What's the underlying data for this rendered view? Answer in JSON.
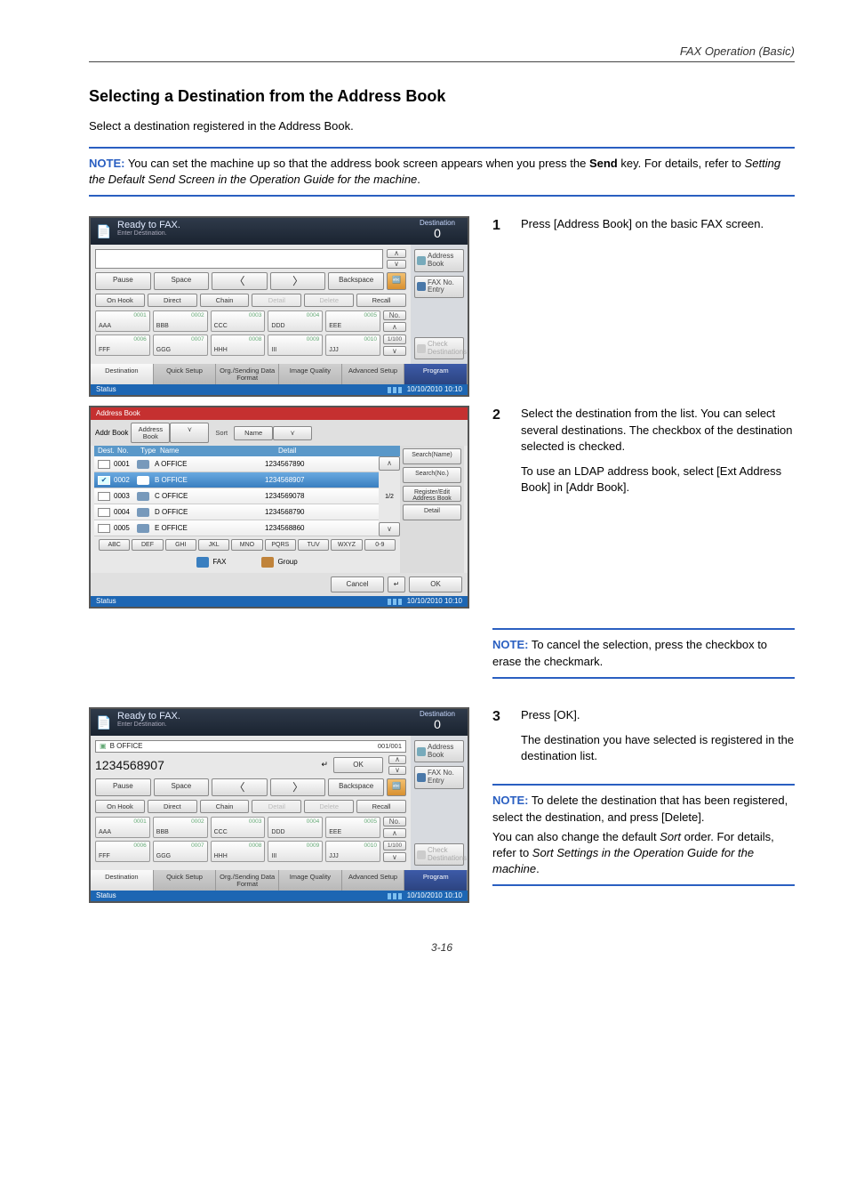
{
  "doc": {
    "running_header": "FAX Operation (Basic)",
    "section_title": "Selecting a Destination from the Address Book",
    "intro": "Select a destination registered in the Address Book.",
    "note1_label": "NOTE:",
    "note1_body_a": " You can set the machine up so that the address book screen appears when you press the ",
    "note1_body_b": "Send",
    "note1_body_c": " key. For details, refer to ",
    "note1_body_d": "Setting the Default Send Screen in the Operation Guide for the machine",
    "note1_body_e": ".",
    "step1_num": "1",
    "step1_text": "Press [Address Book] on the basic FAX screen.",
    "step2_num": "2",
    "step2_text1": "Select the destination from the list. You can select several destinations. The checkbox of the destination selected is checked.",
    "step2_text2": "To use an LDAP address book, select [Ext Address Book] in [Addr Book].",
    "note2_label": "NOTE:",
    "note2_body": " To cancel the selection, press the checkbox to erase the checkmark.",
    "step3_num": "3",
    "step3_text1": "Press [OK].",
    "step3_text2": "The destination you have selected is registered in the destination list.",
    "note3_label": "NOTE:",
    "note3_body": " To delete the destination that has been registered, select the destination, and press [Delete].",
    "note3_extra_a": "You can also change the default ",
    "note3_extra_b": "Sort",
    "note3_extra_c": " order. For details, refer to ",
    "note3_extra_d": "Sort Settings in the Operation Guide for the machine",
    "note3_extra_e": ".",
    "page_number": "3-16"
  },
  "scr1": {
    "title1": "Ready to FAX.",
    "title2": "Enter Destination.",
    "dest_label": "Destination",
    "dest_count": "0",
    "side_addr_book": "Address Book",
    "side_fax_entry": "FAX No. Entry",
    "side_check": "Check Destinations",
    "pause": "Pause",
    "space": "Space",
    "backspace": "Backspace",
    "onhook": "On Hook",
    "direct": "Direct",
    "chain": "Chain",
    "detail": "Detail",
    "delete": "Delete",
    "recall": "Recall",
    "no_label": "No.",
    "page_ind": "1/100",
    "cells": [
      {
        "n": "0001",
        "l": "AAA"
      },
      {
        "n": "0002",
        "l": "BBB"
      },
      {
        "n": "0003",
        "l": "CCC"
      },
      {
        "n": "0004",
        "l": "DDD"
      },
      {
        "n": "0005",
        "l": "EEE"
      },
      {
        "n": "0006",
        "l": "FFF"
      },
      {
        "n": "0007",
        "l": "GGG"
      },
      {
        "n": "0008",
        "l": "HHH"
      },
      {
        "n": "0009",
        "l": "III"
      },
      {
        "n": "0010",
        "l": "JJJ"
      }
    ],
    "btabs": [
      "Destination",
      "Quick Setup",
      "Org./Sending Data Format",
      "Image Quality",
      "Advanced Setup",
      "Program"
    ],
    "status": "Status",
    "datetime": "10/10/2010  10:10"
  },
  "scr2": {
    "header": "Address Book",
    "addr_book_label": "Addr Book",
    "addr_book_sel": "Address Book",
    "sort_label": "Sort",
    "sort_sel": "Name",
    "thead": [
      "Dest.",
      "No.",
      "Type",
      "Name",
      "Detail"
    ],
    "rows": [
      {
        "no": "0001",
        "name": "A OFFICE",
        "detail": "1234567890",
        "sel": false
      },
      {
        "no": "0002",
        "name": "B OFFICE",
        "detail": "1234568907",
        "sel": true
      },
      {
        "no": "0003",
        "name": "C OFFICE",
        "detail": "1234569078",
        "sel": false
      },
      {
        "no": "0004",
        "name": "D OFFICE",
        "detail": "1234568790",
        "sel": false
      },
      {
        "no": "0005",
        "name": "E OFFICE",
        "detail": "1234568860",
        "sel": false
      }
    ],
    "page_ind": "1/2",
    "side": [
      "Search(Name)",
      "Search(No.)",
      "Register/Edit Address Book",
      "Detail"
    ],
    "letters": [
      "ABC",
      "DEF",
      "GHI",
      "JKL",
      "MNO",
      "PQRS",
      "TUV",
      "WXYZ",
      "0-9"
    ],
    "type_fax": "FAX",
    "type_group": "Group",
    "cancel": "Cancel",
    "ok": "OK",
    "status": "Status",
    "datetime": "10/10/2010  10:10"
  },
  "scr3": {
    "title1": "Ready to FAX.",
    "title2": "Enter Destination.",
    "dest_label": "Destination",
    "dest_count": "0",
    "sel_name": "B OFFICE",
    "sel_count": "001/001",
    "sel_number": "1234568907",
    "ok": "OK",
    "side_addr_book": "Address Book",
    "side_fax_entry": "FAX No. Entry",
    "side_check": "Check Destinations",
    "pause": "Pause",
    "space": "Space",
    "backspace": "Backspace",
    "onhook": "On Hook",
    "direct": "Direct",
    "chain": "Chain",
    "detail": "Detail",
    "delete": "Delete",
    "recall": "Recall",
    "no_label": "No.",
    "page_ind": "1/100",
    "cells": [
      {
        "n": "0001",
        "l": "AAA"
      },
      {
        "n": "0002",
        "l": "BBB"
      },
      {
        "n": "0003",
        "l": "CCC"
      },
      {
        "n": "0004",
        "l": "DDD"
      },
      {
        "n": "0005",
        "l": "EEE"
      },
      {
        "n": "0006",
        "l": "FFF"
      },
      {
        "n": "0007",
        "l": "GGG"
      },
      {
        "n": "0008",
        "l": "HHH"
      },
      {
        "n": "0009",
        "l": "III"
      },
      {
        "n": "0010",
        "l": "JJJ"
      }
    ],
    "btabs": [
      "Destination",
      "Quick Setup",
      "Org./Sending Data Format",
      "Image Quality",
      "Advanced Setup",
      "Program"
    ],
    "status": "Status",
    "datetime": "10/10/2010  10:10"
  }
}
